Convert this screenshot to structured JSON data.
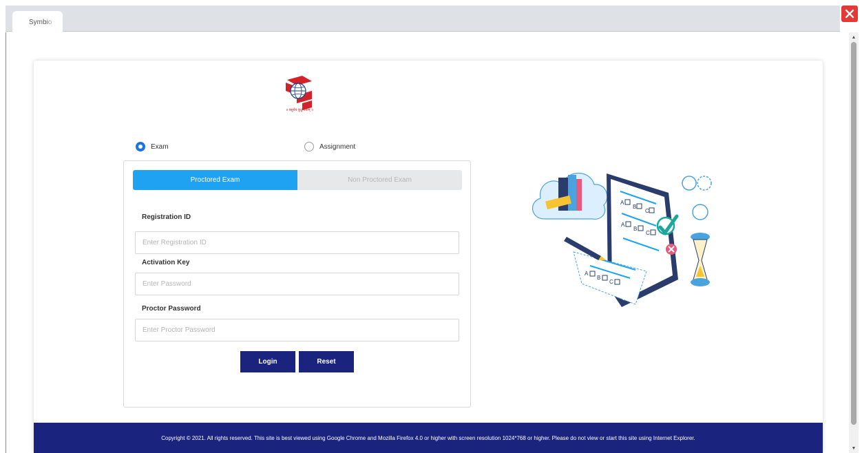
{
  "browser": {
    "tab_title": "Symbio",
    "close_label": "Close"
  },
  "logo": {
    "caption": "॥ वसुधैव कुटुम्बकम् ॥"
  },
  "mode": {
    "options": [
      {
        "label": "Exam",
        "selected": true
      },
      {
        "label": "Assignment",
        "selected": false
      }
    ]
  },
  "exam_tabs": {
    "proctored": "Proctored Exam",
    "non_proctored": "Non Proctored Exam"
  },
  "form": {
    "registration_label": "Registration ID",
    "registration_placeholder": "Enter Registration ID",
    "activation_label": "Activation Key",
    "activation_placeholder": "Enter Password",
    "proctor_label": "Proctor Password",
    "proctor_placeholder": "Enter Proctor Password",
    "login_label": "Login",
    "reset_label": "Reset"
  },
  "illustration": {
    "answer_letters": [
      "A",
      "B",
      "C",
      "A",
      "B",
      "C",
      "A",
      "B",
      "C"
    ]
  },
  "footer": {
    "text": "Copyright © 2021. All rights reserved. This site is best viewed using Google Chrome and Mozilla Firefox 4.0 or higher with screen resolution 1024*768 or higher. Please do not view or start this site using Internet Explorer."
  },
  "colors": {
    "primary_tab": "#1fa2f2",
    "button": "#1a237e",
    "footer": "#1a237e",
    "close": "#e53935"
  }
}
